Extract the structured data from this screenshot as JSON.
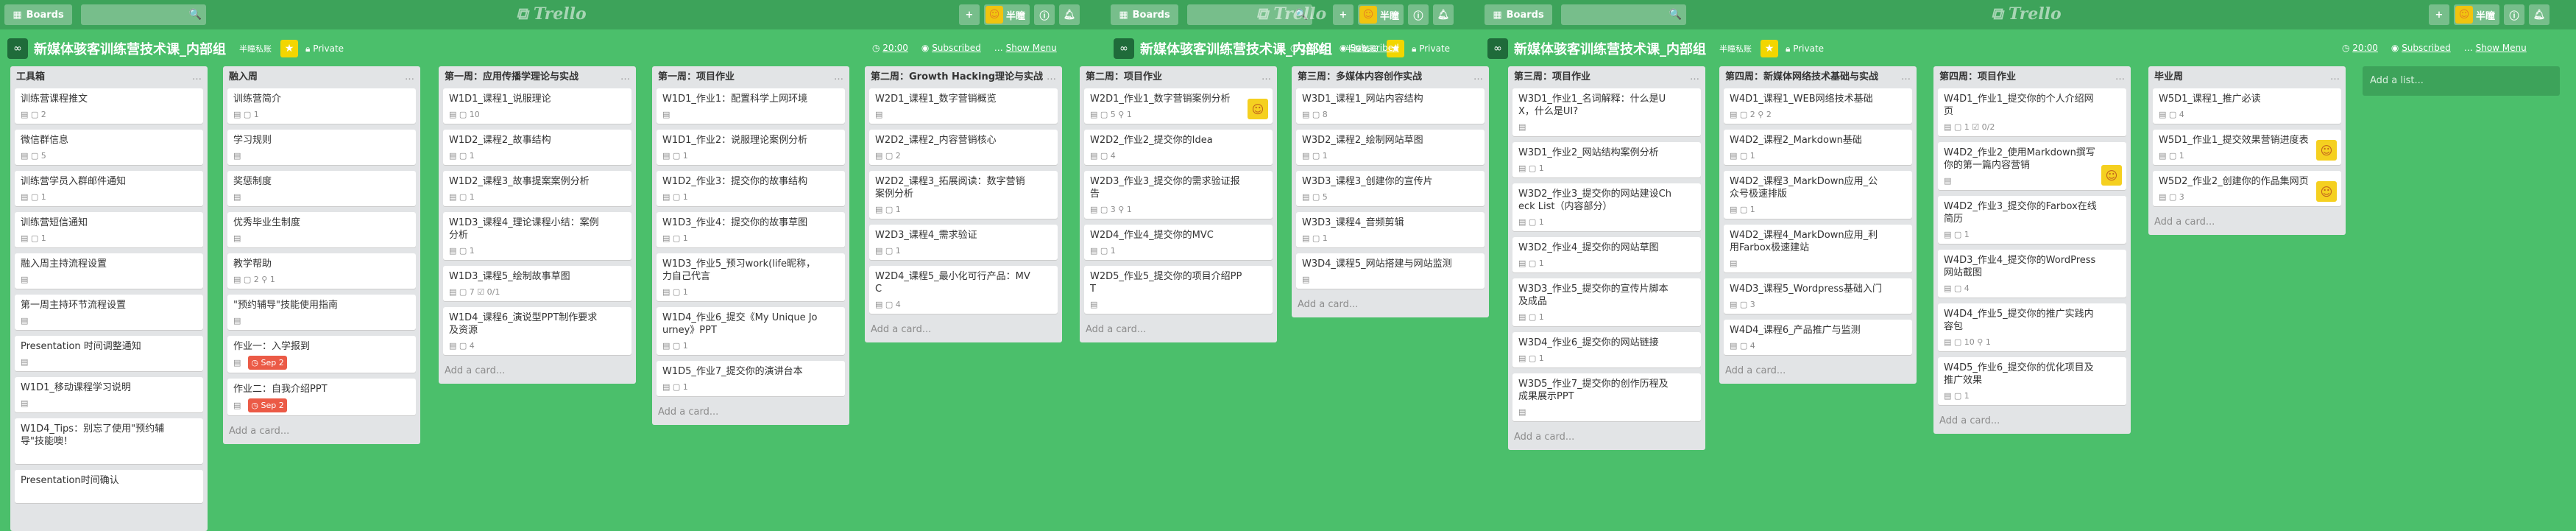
{
  "header": {
    "boards": "Boards",
    "user": "半瞳",
    "search_icon": "🔍"
  },
  "board": {
    "title": "新媒体骇客训练营技术课_内部组",
    "team": "半瞳私账",
    "privacy": "Private",
    "time": "20:00",
    "subscribed": "Subscribed",
    "menu": "Show Menu"
  },
  "lists": [
    {
      "name": "工具箱",
      "cards": [
        {
          "t": "训练营课程推文",
          "b": "▤  ▢ 2"
        },
        {
          "t": "微信群信息",
          "b": "▤  ▢ 5"
        },
        {
          "t": "训练营学员入群邮件通知",
          "b": "▤  ▢ 1"
        },
        {
          "t": "训练营短信通知",
          "b": "▤  ▢ 1"
        },
        {
          "t": "融入周主持流程设置",
          "b": "▤"
        },
        {
          "t": "第一周主持环节流程设置",
          "b": "▤"
        },
        {
          "t": "Presentation 时间调整通知",
          "b": "▤"
        },
        {
          "t": "W1D1_移动课程学习说明",
          "b": "▤"
        },
        {
          "t": "W1D4_Tips：别忘了使用\"预约辅导\"技能噢！",
          "b": ""
        },
        {
          "t": "Presentation时间确认",
          "b": ""
        }
      ],
      "add": ""
    },
    {
      "name": "融入周",
      "cards": [
        {
          "t": "训练营简介",
          "b": "▤  ▢ 1"
        },
        {
          "t": "学习规则",
          "b": "▤"
        },
        {
          "t": "奖惩制度",
          "b": "▤"
        },
        {
          "t": "优秀毕业生制度",
          "b": "▤"
        },
        {
          "t": "教学帮助",
          "b": "▤  ▢ 2  ⚲ 1"
        },
        {
          "t": "\"预约辅导\"技能使用指南",
          "b": "▤"
        },
        {
          "t": "作业一：入学报到",
          "b": "▤",
          "due": "Sep 2"
        },
        {
          "t": "作业二：自我介绍PPT",
          "b": "▤",
          "due": "Sep 2"
        }
      ],
      "add": "Add a card..."
    },
    {
      "name": "第一周：应用传播学理论与实战",
      "cards": [
        {
          "t": "W1D1_课程1_说服理论",
          "b": "▤  ▢ 10"
        },
        {
          "t": "W1D2_课程2_故事结构",
          "b": "▤  ▢ 1"
        },
        {
          "t": "W1D2_课程3_故事提案案例分析",
          "b": "▤  ▢ 1"
        },
        {
          "t": "W1D3_课程4_理论课程小结：案例分析",
          "b": "▤  ▢ 1"
        },
        {
          "t": "W1D3_课程5_绘制故事草图",
          "b": "▤  ▢ 7  ☑ 0/1"
        },
        {
          "t": "W1D4_课程6_演说型PPT制作要求及资源",
          "b": "▤  ▢ 4"
        }
      ],
      "add": "Add a card..."
    },
    {
      "name": "第一周：项目作业",
      "cards": [
        {
          "t": "W1D1_作业1：配置科学上网环境",
          "b": "▤"
        },
        {
          "t": "W1D1_作业2：说服理论案例分析",
          "b": "▤  ▢ 1"
        },
        {
          "t": "W1D2_作业3：提交你的故事结构",
          "b": "▤  ▢ 1"
        },
        {
          "t": "W1D3_作业4：提交你的故事草图",
          "b": "▤  ▢ 1"
        },
        {
          "t": "W1D3_作业5_预习work(life昵称，力自己代言",
          "b": "▤  ▢ 1"
        },
        {
          "t": "W1D4_作业6_提交《My Unique Journey》PPT",
          "b": "▤  ▢ 1"
        },
        {
          "t": "W1D5_作业7_提交你的演讲台本",
          "b": "▤  ▢ 1"
        }
      ],
      "add": "Add a card..."
    },
    {
      "name": "第二周：Growth Hacking理论与实战",
      "cards": [
        {
          "t": "W2D1_课程1_数字营销概览",
          "b": "▤"
        },
        {
          "t": "W2D2_课程2_内容营销核心",
          "b": "▤  ▢ 2"
        },
        {
          "t": "W2D2_课程3_拓展阅读：数字营销案例分析",
          "b": "▤  ▢ 1"
        },
        {
          "t": "W2D3_课程4_需求验证",
          "b": "▤  ▢ 1"
        },
        {
          "t": "W2D4_课程5_最小化可行产品：MVC",
          "b": "▤  ▢ 4"
        }
      ],
      "add": "Add a card..."
    },
    {
      "name": "第二周：项目作业",
      "cards": [
        {
          "t": "W2D1_作业1_数字营销案例分析",
          "b": "▤  ▢ 5  ⚲ 1",
          "av": 1
        },
        {
          "t": "W2D2_作业2_提交你的Idea",
          "b": "▤  ▢ 4"
        },
        {
          "t": "W2D3_作业3_提交你的需求验证报告",
          "b": "▤  ▢ 3  ⚲ 1"
        },
        {
          "t": "W2D4_作业4_提交你的MVC",
          "b": "▤  ▢ 1"
        },
        {
          "t": "W2D5_作业5_提交你的项目介绍PPT",
          "b": "▤"
        }
      ],
      "add": "Add a card..."
    },
    {
      "name": "第三周：多媒体内容创作实战",
      "cards": [
        {
          "t": "W3D1_课程1_网站内容结构",
          "b": "▤  ▢ 8"
        },
        {
          "t": "W3D2_课程2_绘制网站草图",
          "b": "▤  ▢ 1"
        },
        {
          "t": "W3D3_课程3_创建你的宣传片",
          "b": "▤  ▢ 5"
        },
        {
          "t": "W3D3_课程4_音频剪辑",
          "b": "▤  ▢ 1"
        },
        {
          "t": "W3D4_课程5_网站搭建与网站监测",
          "b": "▤"
        }
      ],
      "add": "Add a card..."
    },
    {
      "name": "第三周：项目作业",
      "cards": [
        {
          "t": "W3D1_作业1_名词解释：什么是UX，什么是UI?",
          "b": "▤"
        },
        {
          "t": "W3D1_作业2_网站结构案例分析",
          "b": "▤  ▢ 1"
        },
        {
          "t": "W3D2_作业3_提交你的网站建设Check List（内容部分）",
          "b": "▤  ▢ 1"
        },
        {
          "t": "W3D2_作业4_提交你的网站草图",
          "b": "▤  ▢ 1"
        },
        {
          "t": "W3D3_作业5_提交你的宣传片脚本及成品",
          "b": "▤  ▢ 1"
        },
        {
          "t": "W3D4_作业6_提交你的网站链接",
          "b": "▤  ▢ 1"
        },
        {
          "t": "W3D5_作业7_提交你的创作历程及成果展示PPT",
          "b": "▤"
        }
      ],
      "add": "Add a card..."
    },
    {
      "name": "第四周：新媒体网络技术基础与实战",
      "cards": [
        {
          "t": "W4D1_课程1_WEB网络技术基础",
          "b": "▤  ▢ 2  ⚲ 2"
        },
        {
          "t": "W4D2_课程2_Markdown基础",
          "b": "▤  ▢ 1"
        },
        {
          "t": "W4D2_课程3_MarkDown应用_公众号极速排版",
          "b": "▤  ▢ 1"
        },
        {
          "t": "W4D2_课程4_MarkDown应用_利用Farbox极速建站",
          "b": "▤"
        },
        {
          "t": "W4D3_课程5_Wordpress基础入门",
          "b": "▤  ▢ 3"
        },
        {
          "t": "W4D4_课程6_产品推广与监测",
          "b": "▤  ▢ 4"
        }
      ],
      "add": "Add a card..."
    },
    {
      "name": "第四周：项目作业",
      "cards": [
        {
          "t": "W4D1_作业1_提交你的个人介绍网页",
          "b": "▤  ▢ 1  ☑ 0/2"
        },
        {
          "t": "W4D2_作业2_使用Markdown撰写你的第一篇内容营销",
          "b": "▤",
          "av": 1
        },
        {
          "t": "W4D2_作业3_提交你的Farbox在线简历",
          "b": "▤  ▢ 1"
        },
        {
          "t": "W4D3_作业4_提交你的WordPress网站截图",
          "b": "▤  ▢ 4"
        },
        {
          "t": "W4D4_作业5_提交你的推广实践内容包",
          "b": "▤  ▢ 10  ⚲ 1"
        },
        {
          "t": "W4D5_作业6_提交你的优化项目及推广效果",
          "b": "▤  ▢ 1"
        }
      ],
      "add": "Add a card..."
    },
    {
      "name": "毕业周",
      "cards": [
        {
          "t": "W5D1_课程1_推广必读",
          "b": "▤  ▢ 4"
        },
        {
          "t": "W5D1_作业1_提交效果营销进度表",
          "b": "▤  ▢ 1",
          "av": 1
        },
        {
          "t": "W5D2_作业2_创建你的作品集网页",
          "b": "▤  ▢ 3",
          "av": 1
        }
      ],
      "add": "Add a card..."
    }
  ],
  "add_list": "Add a list...",
  "colors": {
    "bg": "#4bbf6b",
    "header": "#3da35a",
    "list": "#e2e4e6",
    "due": "#eb5a46"
  }
}
